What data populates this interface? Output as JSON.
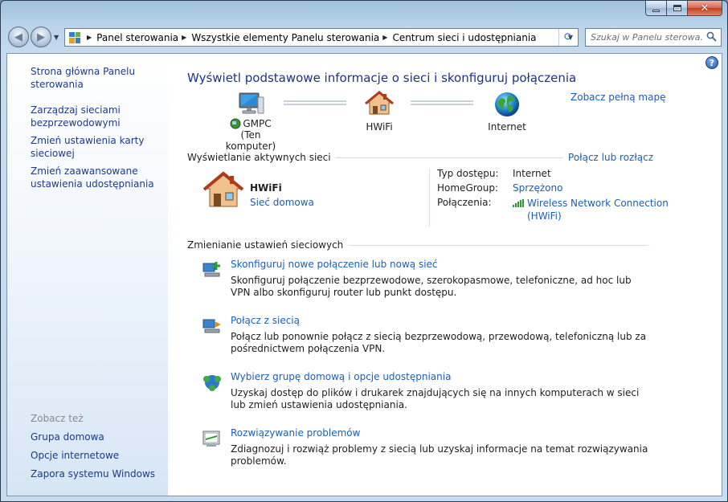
{
  "window": {
    "controls": {
      "minimize": "minimize",
      "maximize": "maximize",
      "close": "close"
    }
  },
  "address_bar": {
    "breadcrumbs": [
      "Panel sterowania",
      "Wszystkie elementy Panelu sterowania",
      "Centrum sieci i udostępniania"
    ]
  },
  "search": {
    "placeholder": "Szukaj w Panelu sterowa..."
  },
  "sidebar": {
    "top_links": [
      "Strona główna Panelu sterowania",
      "Zarządzaj sieciami bezprzewodowymi",
      "Zmień ustawienia karty sieciowej",
      "Zmień zaawansowane ustawienia udostępniania"
    ],
    "see_also_label": "Zobacz też",
    "see_also_links": [
      "Grupa domowa",
      "Opcje internetowe",
      "Zapora systemu Windows"
    ]
  },
  "main": {
    "title": "Wyświetl podstawowe informacje o sieci i skonfiguruj połączenia",
    "full_map_link": "Zobacz pełną mapę",
    "map": {
      "computer_name": "GMPC",
      "computer_sub": "(Ten komputer)",
      "network": "HWiFi",
      "internet": "Internet"
    },
    "active_section": {
      "heading": "Wyświetlanie aktywnych sieci",
      "connect_link": "Połącz lub rozłącz",
      "network_name": "HWiFi",
      "network_type": "Sieć domowa",
      "access_type_label": "Typ dostępu:",
      "access_type_value": "Internet",
      "homegroup_label": "HomeGroup:",
      "homegroup_value": "Sprzężono",
      "connections_label": "Połączenia:",
      "connection_line1": "Wireless Network Connection",
      "connection_line2": "(HWiFi)"
    },
    "change_section": {
      "heading": "Zmienianie ustawień sieciowych",
      "tasks": [
        {
          "title": "Skonfiguruj nowe połączenie lub nową sieć",
          "desc": "Skonfiguruj połączenie bezprzewodowe, szerokopasmowe, telefoniczne, ad hoc lub VPN albo skonfiguruj router lub punkt dostępu."
        },
        {
          "title": "Połącz z siecią",
          "desc": "Połącz lub ponownie połącz z siecią bezprzewodową, przewodową, telefoniczną lub za pośrednictwem połączenia VPN."
        },
        {
          "title": "Wybierz grupę domową i opcje udostępniania",
          "desc": "Uzyskaj dostęp do plików i drukarek znajdujących się na innych komputerach w sieci lub zmień ustawienia udostępniania."
        },
        {
          "title": "Rozwiązywanie problemów",
          "desc": "Zdiagnozuj i rozwiąż problemy z siecią lub uzyskaj informacje na temat rozwiązywania problemów."
        }
      ]
    }
  }
}
